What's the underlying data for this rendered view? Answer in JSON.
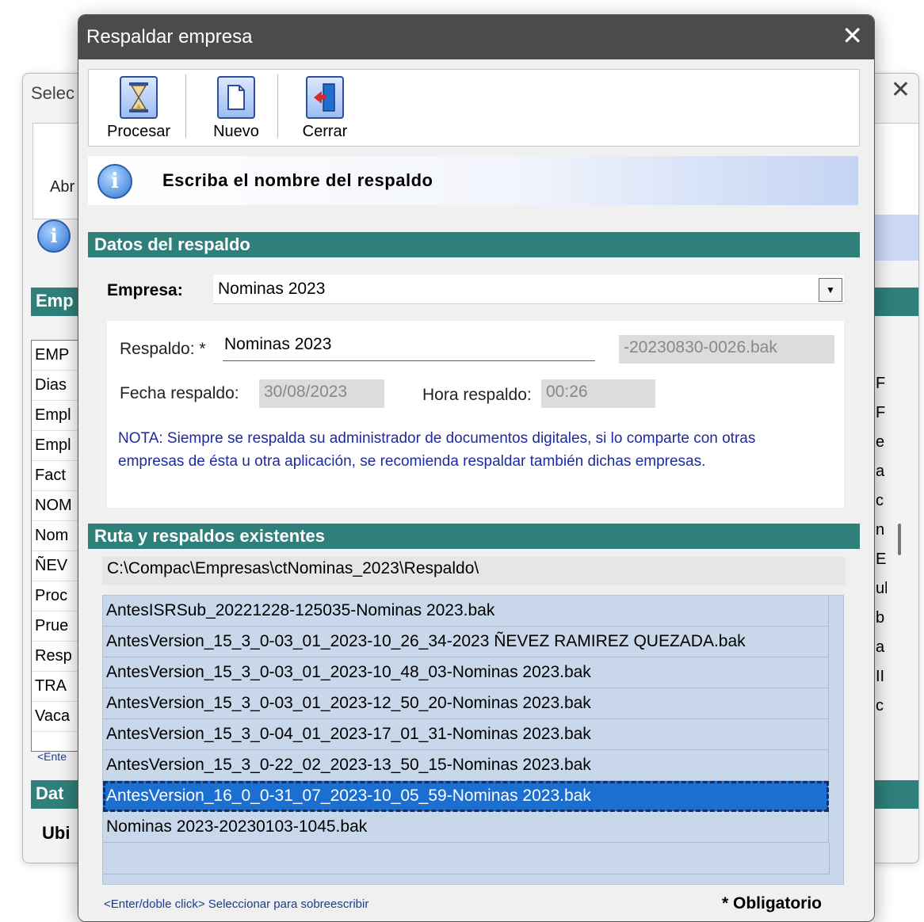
{
  "background_window": {
    "title_partial": "Selec",
    "close_glyph": "✕",
    "abr_label": "Abr",
    "section_label": "Emp",
    "list_items": [
      "EMP",
      "Dias",
      "Empl",
      "Empl",
      "Fact",
      "NOM",
      "Nom",
      "ÑEV",
      "Proc",
      "Prue",
      "Resp",
      "TRA",
      "Vaca"
    ],
    "right_column": [
      "F",
      "F",
      "e",
      "a",
      "c",
      "n",
      "E",
      "ul",
      "b",
      "a",
      "II",
      "c"
    ],
    "hint_partial": "<Ente",
    "section2_label": "Dat",
    "ubi_label": "Ubi"
  },
  "dialog": {
    "title": "Respaldar empresa",
    "close_glyph": "✕",
    "toolbar": {
      "procesar": "Procesar",
      "nuevo": "Nuevo",
      "cerrar": "Cerrar"
    },
    "info_message": "Escriba el nombre del respaldo",
    "section_datos": "Datos del respaldo",
    "empresa_label": "Empresa:",
    "empresa_value": "Nominas 2023",
    "combo_arrow": "▼",
    "respaldo_label": "Respaldo: *",
    "respaldo_value": "Nominas 2023",
    "respaldo_suffix": "-20230830-0026.bak",
    "fecha_label": "Fecha respaldo:",
    "fecha_value": "30/08/2023",
    "hora_label": "Hora respaldo:",
    "hora_value": "00:26",
    "nota": "NOTA: Siempre se respalda su administrador de documentos digitales, si lo comparte con otras empresas de ésta u otra aplicación, se recomienda respaldar también dichas empresas.",
    "section_ruta": "Ruta y respaldos existentes",
    "ruta_value": "C:\\Compac\\Empresas\\ctNominas_2023\\Respaldo\\",
    "backups": [
      "AntesISRSub_20221228-125035-Nominas 2023.bak",
      "AntesVersion_15_3_0-03_01_2023-10_26_34-2023 ÑEVEZ RAMIREZ QUEZADA.bak",
      "AntesVersion_15_3_0-03_01_2023-10_48_03-Nominas 2023.bak",
      "AntesVersion_15_3_0-03_01_2023-12_50_20-Nominas 2023.bak",
      "AntesVersion_15_3_0-04_01_2023-17_01_31-Nominas 2023.bak",
      "AntesVersion_15_3_0-22_02_2023-13_50_15-Nominas 2023.bak",
      "AntesVersion_16_0_0-31_07_2023-10_05_59-Nominas 2023.bak",
      "Nominas 2023-20230103-1045.bak"
    ],
    "selected_backup_index": 6,
    "hint": "<Enter/doble click> Seleccionar para sobreescribir",
    "obligatorio": "* Obligatorio"
  }
}
